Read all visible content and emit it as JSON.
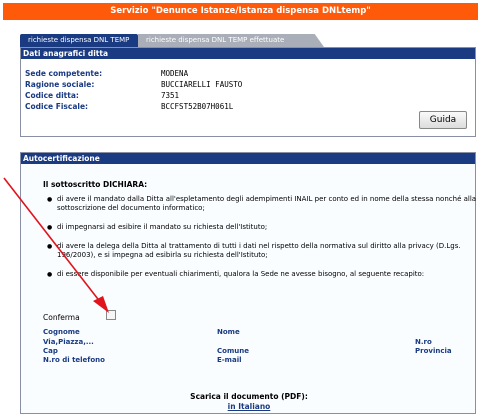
{
  "service_title": "Servizio \"Denunce Istanze/Istanza dispensa DNLtemp\"",
  "tabs": [
    {
      "label": "richieste dispensa DNL TEMP"
    },
    {
      "label": "richieste dispensa DNL TEMP effettuate"
    }
  ],
  "ditta": {
    "header": "Dati anagrafici ditta",
    "rows": [
      {
        "label": "Sede competente:",
        "value": "MODENA"
      },
      {
        "label": "Ragione sociale:",
        "value": "BUCCIARELLI FAUSTO"
      },
      {
        "label": "Codice ditta:",
        "value": "7351"
      },
      {
        "label": "Codice Fiscale:",
        "value": "BCCFST52B07H061L"
      }
    ],
    "guida_label": "Guida"
  },
  "autocert": {
    "header": "Autocertificazione",
    "dichiara": "Il sottoscritto DICHIARA:",
    "bullets": [
      "di avere il mandato dalla Ditta all'espletamento degli adempimenti INAIL per conto ed in nome della stessa nonché alla sottoscrizione del documento informatico;",
      "di impegnarsi ad esibire il mandato su richiesta dell'Istituto;",
      "di avere la delega della Ditta al trattamento di tutti i dati nel rispetto della normativa sul diritto alla privacy (D.Lgs. 196/2003), e si impegna ad esibirla su richiesta dell'Istituto;",
      "di essere disponibile per eventuali chiarimenti, qualora la Sede ne avesse bisogno, al seguente recapito:"
    ],
    "conferma": "Conferma",
    "fields": {
      "cognome": "Cognome",
      "nome": "Nome",
      "via": "Via,Piazza,...",
      "nro": "N.ro",
      "cap": "Cap",
      "comune": "Comune",
      "provincia": "Provincia",
      "telefono": "N.ro di telefono",
      "email": "E-mail"
    },
    "scarica": "Scarica il documento (PDF):",
    "link_italiano": "in Italiano"
  },
  "colors": {
    "service_bar": "#ff5a0a",
    "header_blue": "#1a3a82",
    "arrow_red": "#e0141c"
  }
}
